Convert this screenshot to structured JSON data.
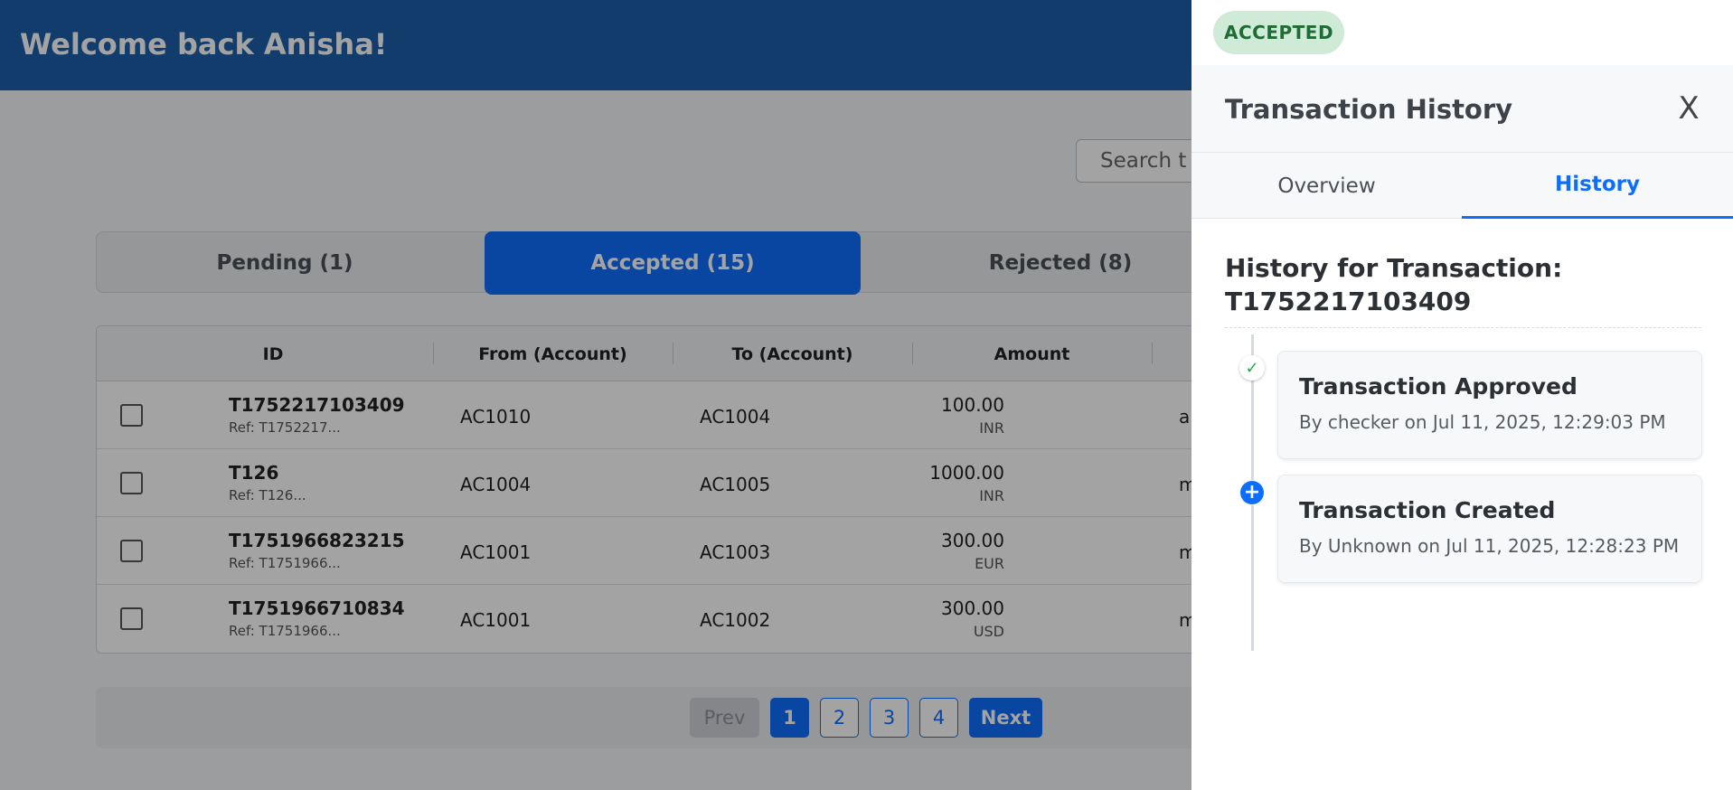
{
  "header": {
    "welcome": "Welcome back Anisha!"
  },
  "search": {
    "placeholder": "Search t"
  },
  "status_tabs": [
    {
      "label": "Pending (1)",
      "active": false
    },
    {
      "label": "Accepted (15)",
      "active": true
    },
    {
      "label": "Rejected (8)",
      "active": false
    }
  ],
  "table": {
    "columns": [
      "ID",
      "From (Account)",
      "To (Account)",
      "Amount"
    ],
    "rows": [
      {
        "id": "T1752217103409",
        "ref": "Ref: T1752217...",
        "from": "AC1010",
        "to": "AC1004",
        "amount": "100.00",
        "currency": "INR",
        "by": "a"
      },
      {
        "id": "T126",
        "ref": "Ref: T126...",
        "from": "AC1004",
        "to": "AC1005",
        "amount": "1000.00",
        "currency": "INR",
        "by": "m"
      },
      {
        "id": "T1751966823215",
        "ref": "Ref: T1751966...",
        "from": "AC1001",
        "to": "AC1003",
        "amount": "300.00",
        "currency": "EUR",
        "by": "m"
      },
      {
        "id": "T1751966710834",
        "ref": "Ref: T1751966...",
        "from": "AC1001",
        "to": "AC1002",
        "amount": "300.00",
        "currency": "USD",
        "by": "m"
      }
    ]
  },
  "pagination": {
    "prev": "Prev",
    "pages": [
      "1",
      "2",
      "3",
      "4"
    ],
    "current": "1",
    "next": "Next"
  },
  "panel": {
    "status_badge": "ACCEPTED",
    "title": "Transaction History",
    "close_label": "X",
    "tabs": [
      {
        "label": "Overview",
        "active": false
      },
      {
        "label": "History",
        "active": true
      }
    ],
    "history_heading_line1": "History for Transaction:",
    "history_heading_line2": "T1752217103409",
    "events": [
      {
        "title": "Transaction Approved",
        "meta": "By checker on Jul 11, 2025, 12:29:03 PM",
        "icon": "check-icon"
      },
      {
        "title": "Transaction Created",
        "meta": "By Unknown on Jul 11, 2025, 12:28:23 PM",
        "icon": "plus-circle-icon"
      }
    ]
  },
  "colors": {
    "topbar": "#1b5faa",
    "primary": "#0d6efd",
    "accepted_badge_bg": "#cfead6",
    "accepted_badge_text": "#1e6b34",
    "approved_check": "#28a745"
  }
}
